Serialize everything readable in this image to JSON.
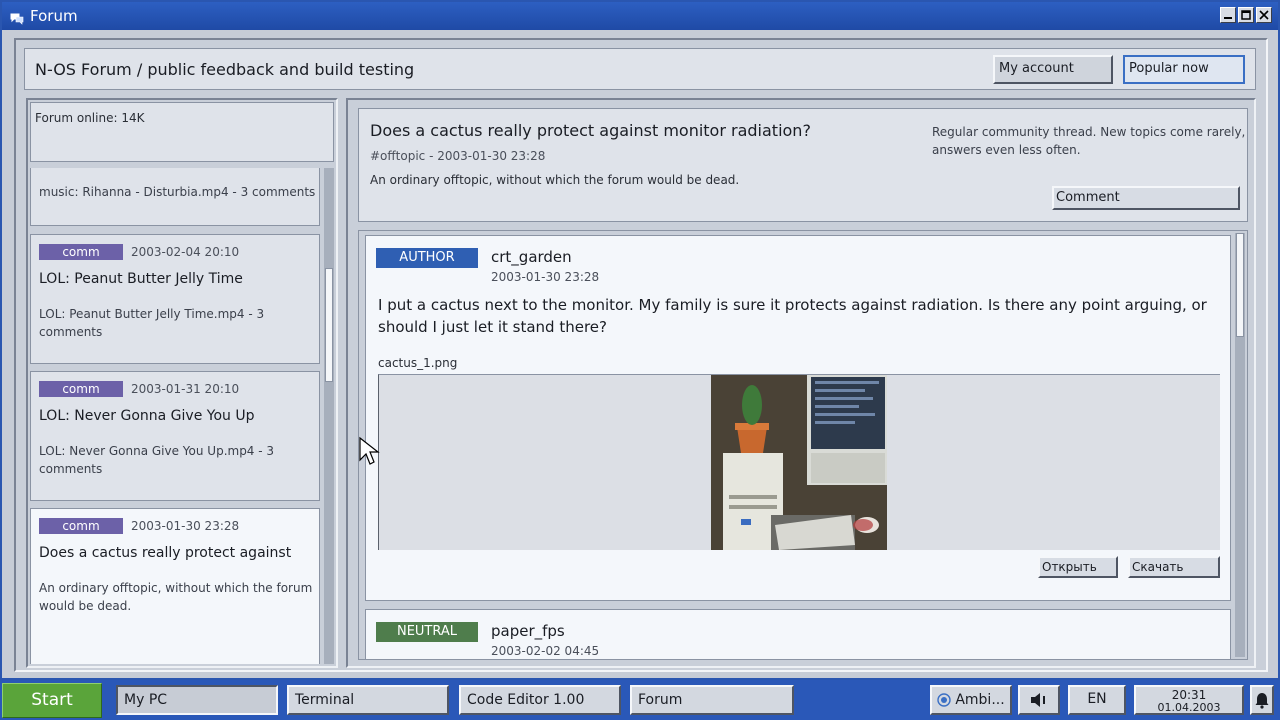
{
  "window": {
    "title": "Forum",
    "controls": [
      "minimize-icon",
      "maximize-icon",
      "close-icon"
    ]
  },
  "header": {
    "title": "N-OS Forum / public feedback and build testing",
    "account_btn": "My account",
    "popular_btn": "Popular now"
  },
  "sidebar": {
    "online": "Forum online: 14K",
    "items": [
      {
        "only": "music: Rihanna - Disturbia.mp4 - 3 comments"
      },
      {
        "tag": "comm",
        "date": "2003-02-04 20:10",
        "title": "LOL: Peanut Butter Jelly Time",
        "desc": "LOL: Peanut Butter Jelly Time.mp4 - 3 comments"
      },
      {
        "tag": "comm",
        "date": "2003-01-31 20:10",
        "title": "LOL: Never Gonna Give You Up",
        "desc": "LOL: Never Gonna Give You Up.mp4 - 3 comments"
      },
      {
        "tag": "comm",
        "date": "2003-01-30 23:28",
        "title": "Does a cactus really protect against",
        "desc": "An ordinary offtopic, without which the forum would be dead."
      }
    ]
  },
  "thread": {
    "title": "Does a cactus really protect against monitor radiation?",
    "meta": "#offtopic - 2003-01-30 23:28",
    "desc": "An ordinary offtopic, without which the forum would be dead.",
    "note": "Regular community thread. New topics come rarely, answers even less often.",
    "comment_btn": "Comment"
  },
  "posts": [
    {
      "role": "AUTHOR",
      "user": "crt_garden",
      "date": "2003-01-30 23:28",
      "text": "I put a cactus next to the monitor. My family is sure it protects against radiation. Is there any point arguing, or should I just let it stand there?",
      "attachment": {
        "name": "cactus_1.png",
        "open_btn": "Открыть",
        "download_btn": "Скачать"
      }
    },
    {
      "role": "NEUTRAL",
      "user": "paper_fps",
      "date": "2003-02-02 04:45"
    }
  ],
  "taskbar": {
    "start": "Start",
    "tasks": [
      "My PC",
      "Terminal",
      "Code Editor 1.00",
      "Forum"
    ],
    "ambient": "Ambi...",
    "lang": "EN",
    "time": "20:31",
    "date": "01.04.2003"
  },
  "colors": {
    "titlebar": "#2d5fc2",
    "author_badge": "#2f5fb3",
    "neutral_badge": "#4f7d4c",
    "comm_tag": "#6c61a8",
    "start": "#5aa43a",
    "taskbar": "#2a58b8"
  }
}
